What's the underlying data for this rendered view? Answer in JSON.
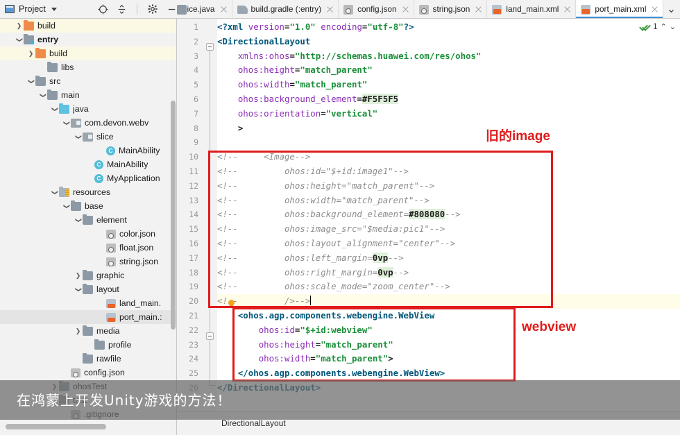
{
  "toolbar": {
    "project_label": "Project",
    "icons": [
      {
        "name": "locate-icon",
        "glyph": "⊕"
      },
      {
        "name": "collapse-all-icon",
        "glyph": "≑"
      },
      {
        "name": "settings-gear-icon",
        "glyph": "✿"
      },
      {
        "name": "minimize-icon",
        "glyph": "—"
      }
    ]
  },
  "tabs": [
    {
      "label": "Slice.java",
      "icon": "java-file-icon",
      "active": false,
      "truncated": true
    },
    {
      "label": "build.gradle (:entry)",
      "icon": "gradle-file-icon",
      "active": false
    },
    {
      "label": "config.json",
      "icon": "json-file-icon",
      "active": false
    },
    {
      "label": "string.json",
      "icon": "json-file-icon",
      "active": false
    },
    {
      "label": "land_main.xml",
      "icon": "xml-file-icon",
      "active": false
    },
    {
      "label": "port_main.xml",
      "icon": "xml-file-icon",
      "active": true
    }
  ],
  "tabs_overflow_glyph": "⌄",
  "tree": [
    {
      "label": "build",
      "indent": 1,
      "arrow": "collapsed",
      "icon": "folder-orange",
      "state": "hl"
    },
    {
      "label": "entry",
      "indent": 1,
      "arrow": "expanded",
      "icon": "folder-module",
      "bold": true
    },
    {
      "label": "build",
      "indent": 2,
      "arrow": "collapsed",
      "icon": "folder-orange",
      "state": "hl"
    },
    {
      "label": "libs",
      "indent": 3,
      "arrow": "none",
      "icon": "folder-gray"
    },
    {
      "label": "src",
      "indent": 2,
      "arrow": "expanded",
      "icon": "folder-gray"
    },
    {
      "label": "main",
      "indent": 3,
      "arrow": "expanded",
      "icon": "folder-gray"
    },
    {
      "label": "java",
      "indent": 4,
      "arrow": "expanded",
      "icon": "folder-blue"
    },
    {
      "label": "com.devon.webv",
      "indent": 5,
      "arrow": "expanded",
      "icon": "folder-package"
    },
    {
      "label": "slice",
      "indent": 6,
      "arrow": "expanded",
      "icon": "folder-package"
    },
    {
      "label": "MainAbility",
      "indent": 8,
      "arrow": "none",
      "icon": "class-icon"
    },
    {
      "label": "MainAbility",
      "indent": 7,
      "arrow": "none",
      "icon": "class-icon"
    },
    {
      "label": "MyApplication",
      "indent": 7,
      "arrow": "none",
      "icon": "class-icon"
    },
    {
      "label": "resources",
      "indent": 4,
      "arrow": "expanded",
      "icon": "folder-resources"
    },
    {
      "label": "base",
      "indent": 5,
      "arrow": "expanded",
      "icon": "folder-gray"
    },
    {
      "label": "element",
      "indent": 6,
      "arrow": "expanded",
      "icon": "folder-gray"
    },
    {
      "label": "color.json",
      "indent": 8,
      "arrow": "none",
      "icon": "json-file-icon"
    },
    {
      "label": "float.json",
      "indent": 8,
      "arrow": "none",
      "icon": "json-file-icon"
    },
    {
      "label": "string.json",
      "indent": 8,
      "arrow": "none",
      "icon": "json-file-icon"
    },
    {
      "label": "graphic",
      "indent": 6,
      "arrow": "collapsed",
      "icon": "folder-gray"
    },
    {
      "label": "layout",
      "indent": 6,
      "arrow": "expanded",
      "icon": "folder-gray"
    },
    {
      "label": "land_main.",
      "indent": 8,
      "arrow": "none",
      "icon": "xml-file-icon"
    },
    {
      "label": "port_main.:",
      "indent": 8,
      "arrow": "none",
      "icon": "xml-file-icon",
      "state": "sel"
    },
    {
      "label": "media",
      "indent": 6,
      "arrow": "collapsed",
      "icon": "folder-gray"
    },
    {
      "label": "profile",
      "indent": 7,
      "arrow": "none",
      "icon": "folder-gray"
    },
    {
      "label": "rawfile",
      "indent": 6,
      "arrow": "none",
      "icon": "folder-gray"
    },
    {
      "label": "config.json",
      "indent": 5,
      "arrow": "none",
      "icon": "json-file-icon"
    },
    {
      "label": "ohosTest",
      "indent": 4,
      "arrow": "collapsed",
      "icon": "folder-gray"
    },
    {
      "label": "test",
      "indent": 4,
      "arrow": "collapsed",
      "icon": "folder-gray"
    },
    {
      "label": ".gitignore",
      "indent": 5,
      "arrow": "none",
      "icon": "json-file-icon"
    }
  ],
  "editor": {
    "first_line": 1,
    "last_line": 26,
    "lines": [
      {
        "n": 1,
        "style": "normal",
        "tokens": [
          {
            "t": "<?xml ",
            "c": "tag"
          },
          {
            "t": "version",
            "c": "attr"
          },
          {
            "t": "=",
            "c": "plain"
          },
          {
            "t": "\"1.0\"",
            "c": "val"
          },
          {
            "t": " ",
            "c": "plain"
          },
          {
            "t": "encoding",
            "c": "attr"
          },
          {
            "t": "=",
            "c": "plain"
          },
          {
            "t": "\"utf-8\"",
            "c": "val"
          },
          {
            "t": "?>",
            "c": "tag"
          }
        ],
        "indent": 0
      },
      {
        "n": 2,
        "style": "normal",
        "tokens": [
          {
            "t": "<DirectionalLayout",
            "c": "tag"
          }
        ],
        "indent": 0
      },
      {
        "n": 3,
        "style": "shade",
        "tokens": [
          {
            "t": "xmlns:ohos",
            "c": "attr"
          },
          {
            "t": "=",
            "c": "plain"
          },
          {
            "t": "\"http://schemas.huawei.com/res/ohos\"",
            "c": "val"
          }
        ],
        "indent": 4
      },
      {
        "n": 4,
        "style": "shade",
        "tokens": [
          {
            "t": "ohos:height",
            "c": "attr"
          },
          {
            "t": "=",
            "c": "plain"
          },
          {
            "t": "\"match_parent\"",
            "c": "val"
          }
        ],
        "indent": 4
      },
      {
        "n": 5,
        "style": "shade",
        "tokens": [
          {
            "t": "ohos:width",
            "c": "attr"
          },
          {
            "t": "=",
            "c": "plain"
          },
          {
            "t": "\"match_parent\"",
            "c": "val"
          }
        ],
        "indent": 4
      },
      {
        "n": 6,
        "style": "shade",
        "tokens": [
          {
            "t": "ohos:background_element",
            "c": "attr"
          },
          {
            "t": "=",
            "c": "plain"
          },
          {
            "t": "#F5F5F5",
            "c": "numhl"
          }
        ],
        "indent": 4
      },
      {
        "n": 7,
        "style": "shade",
        "tokens": [
          {
            "t": "ohos:orientation",
            "c": "attr"
          },
          {
            "t": "=",
            "c": "plain"
          },
          {
            "t": "\"vertical\"",
            "c": "val"
          }
        ],
        "indent": 4
      },
      {
        "n": 8,
        "style": "shade",
        "tokens": [
          {
            "t": ">",
            "c": "plain"
          }
        ],
        "indent": 4
      },
      {
        "n": 9,
        "style": "normal",
        "tokens": [],
        "indent": 0
      },
      {
        "n": 10,
        "style": "normal",
        "tokens": [
          {
            "t": "<!--     <Image-->",
            "c": "cmt"
          }
        ],
        "indent": 0
      },
      {
        "n": 11,
        "style": "normal",
        "tokens": [
          {
            "t": "<!--         ohos:id=\"$+id:image1\"-->",
            "c": "cmt"
          }
        ],
        "indent": 0
      },
      {
        "n": 12,
        "style": "normal",
        "tokens": [
          {
            "t": "<!--         ohos:height=\"match_parent\"-->",
            "c": "cmt"
          }
        ],
        "indent": 0
      },
      {
        "n": 13,
        "style": "normal",
        "tokens": [
          {
            "t": "<!--         ohos:width=\"match_parent\"-->",
            "c": "cmt"
          }
        ],
        "indent": 0
      },
      {
        "n": 14,
        "style": "normal",
        "tokens": [
          {
            "t": "<!--         ohos:background_element=",
            "c": "cmt"
          },
          {
            "t": "#808080",
            "c": "numhl"
          },
          {
            "t": "-->",
            "c": "cmt"
          }
        ],
        "indent": 0
      },
      {
        "n": 15,
        "style": "normal",
        "tokens": [
          {
            "t": "<!--         ohos:image_src=\"$media:pic1\"-->",
            "c": "cmt"
          }
        ],
        "indent": 0
      },
      {
        "n": 16,
        "style": "normal",
        "tokens": [
          {
            "t": "<!--         ohos:layout_alignment=\"center\"-->",
            "c": "cmt"
          }
        ],
        "indent": 0
      },
      {
        "n": 17,
        "style": "normal",
        "tokens": [
          {
            "t": "<!--         ohos:left_margin=",
            "c": "cmt"
          },
          {
            "t": "0vp",
            "c": "numhl"
          },
          {
            "t": "-->",
            "c": "cmt"
          }
        ],
        "indent": 0
      },
      {
        "n": 18,
        "style": "normal",
        "tokens": [
          {
            "t": "<!--         ohos:right_margin=",
            "c": "cmt"
          },
          {
            "t": "0vp",
            "c": "numhl"
          },
          {
            "t": "-->",
            "c": "cmt"
          }
        ],
        "indent": 0
      },
      {
        "n": 19,
        "style": "shade",
        "tokens": [
          {
            "t": "<!--         ohos:scale_mode=\"zoom_center\"-->",
            "c": "cmt"
          }
        ],
        "indent": 0
      },
      {
        "n": 20,
        "style": "lit",
        "tokens": [
          {
            "t": "<!--         />-->",
            "c": "cmt"
          },
          {
            "t": "|caret|",
            "c": "caret"
          }
        ],
        "indent": 0
      },
      {
        "n": 21,
        "style": "shade",
        "tokens": [
          {
            "t": "<ohos.agp.components.webengine.WebView",
            "c": "tag"
          }
        ],
        "indent": 4
      },
      {
        "n": 22,
        "style": "shade",
        "tokens": [
          {
            "t": "ohos:id",
            "c": "attr"
          },
          {
            "t": "=",
            "c": "plain"
          },
          {
            "t": "\"$+id:webview\"",
            "c": "val"
          }
        ],
        "indent": 8
      },
      {
        "n": 23,
        "style": "shade",
        "tokens": [
          {
            "t": "ohos:height",
            "c": "attr"
          },
          {
            "t": "=",
            "c": "plain"
          },
          {
            "t": "\"match_parent\"",
            "c": "val"
          }
        ],
        "indent": 8
      },
      {
        "n": 24,
        "style": "shade",
        "tokens": [
          {
            "t": "ohos:width",
            "c": "attr"
          },
          {
            "t": "=",
            "c": "plain"
          },
          {
            "t": "\"match_parent\"",
            "c": "val"
          },
          {
            "t": ">",
            "c": "plain"
          }
        ],
        "indent": 8
      },
      {
        "n": 25,
        "style": "shade",
        "tokens": [
          {
            "t": "</ohos.agp.components.webengine.WebView>",
            "c": "tag"
          }
        ],
        "indent": 4
      },
      {
        "n": 26,
        "style": "normal",
        "tokens": [
          {
            "t": "</DirectionalLayout>",
            "c": "tag"
          }
        ],
        "indent": 0
      }
    ],
    "inspection_count": "1",
    "inspection_up_glyph": "⌃",
    "inspection_down_glyph": "⌄"
  },
  "annotations": [
    {
      "name": "old-image-label",
      "text": "旧的image"
    },
    {
      "name": "webview-label",
      "text": "webview"
    }
  ],
  "breadcrumb": {
    "path": "DirectionalLayout"
  },
  "subtitle": {
    "text": "在鸿蒙上开发Unity游戏的方法！"
  },
  "colors": {
    "accent_tab": "#3d8fd6",
    "annotation_red": "#e01b1b",
    "folder_orange": "#f08c4b",
    "folder_blue": "#5ec2e0",
    "class_icon": "#52bcd8",
    "xml_badge": "#e8652b",
    "tag": "#00567a",
    "attr": "#8b2fb5",
    "value": "#1b8f3a",
    "comment": "#8c8c8c",
    "highlight_line": "#fffce8",
    "highlight_value": "#dff0da"
  }
}
